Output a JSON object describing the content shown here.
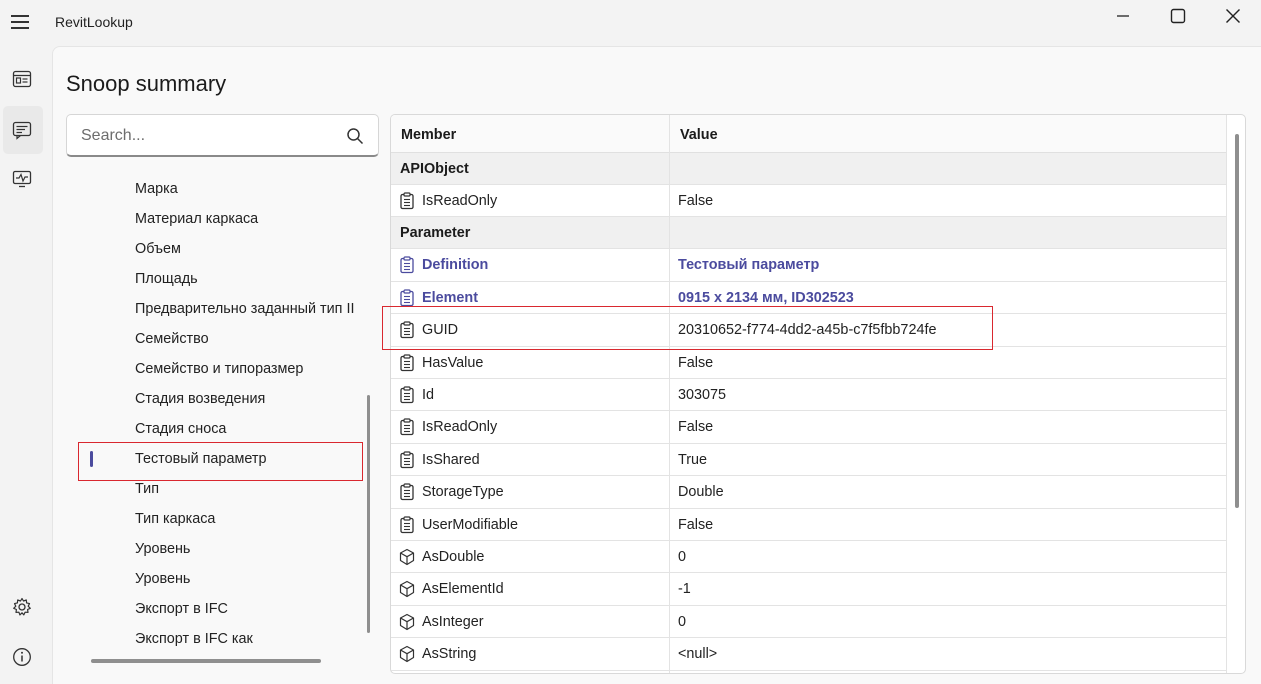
{
  "window": {
    "title": "RevitLookup",
    "icons": {
      "menu": "hamburger-icon",
      "minimize": "minimize-icon",
      "maximize": "maximize-icon",
      "close": "close-icon"
    }
  },
  "rail": {
    "items": [
      {
        "icon": "dashboard-icon"
      },
      {
        "icon": "snoop-summary-icon",
        "active": true
      },
      {
        "icon": "monitor-icon"
      }
    ],
    "bottom": [
      {
        "icon": "gear-icon"
      },
      {
        "icon": "info-icon"
      }
    ]
  },
  "page": {
    "title": "Snoop summary"
  },
  "search": {
    "placeholder": "Search...",
    "value": ""
  },
  "tree": {
    "items": [
      {
        "label": "Марка"
      },
      {
        "label": "Материал каркаса"
      },
      {
        "label": "Объем"
      },
      {
        "label": "Площадь"
      },
      {
        "label": "Предварительно заданный тип II"
      },
      {
        "label": "Семейство"
      },
      {
        "label": "Семейство и типоразмер"
      },
      {
        "label": "Стадия возведения"
      },
      {
        "label": "Стадия сноса"
      },
      {
        "label": "Тестовый параметр",
        "selected": true
      },
      {
        "label": "Тип"
      },
      {
        "label": "Тип каркаса"
      },
      {
        "label": "Уровень"
      },
      {
        "label": "Уровень"
      },
      {
        "label": "Экспорт в IFC"
      },
      {
        "label": "Экспорт в IFC как"
      }
    ]
  },
  "grid": {
    "headers": {
      "member": "Member",
      "value": "Value"
    },
    "rows": [
      {
        "type": "group",
        "name": "APIObject"
      },
      {
        "member": "IsReadOnly",
        "value": "False",
        "icon": "clipboard-icon"
      },
      {
        "type": "group",
        "name": "Parameter"
      },
      {
        "member": "Definition",
        "value": "Тестовый параметр",
        "icon": "clipboard-icon",
        "link": true
      },
      {
        "member": "Element",
        "value": "0915 x 2134 мм, ID302523",
        "icon": "clipboard-icon",
        "link": true
      },
      {
        "member": "GUID",
        "value": "20310652-f774-4dd2-a45b-c7f5fbb724fe",
        "icon": "clipboard-icon"
      },
      {
        "member": "HasValue",
        "value": "False",
        "icon": "clipboard-icon"
      },
      {
        "member": "Id",
        "value": "303075",
        "icon": "clipboard-icon"
      },
      {
        "member": "IsReadOnly",
        "value": "False",
        "icon": "clipboard-icon"
      },
      {
        "member": "IsShared",
        "value": "True",
        "icon": "clipboard-icon"
      },
      {
        "member": "StorageType",
        "value": "Double",
        "icon": "clipboard-icon"
      },
      {
        "member": "UserModifiable",
        "value": "False",
        "icon": "clipboard-icon"
      },
      {
        "member": "AsDouble",
        "value": "0",
        "icon": "cube-icon"
      },
      {
        "member": "AsElementId",
        "value": "-1",
        "icon": "cube-icon"
      },
      {
        "member": "AsInteger",
        "value": "0",
        "icon": "cube-icon"
      },
      {
        "member": "AsString",
        "value": "<null>",
        "icon": "cube-icon"
      }
    ]
  },
  "colors": {
    "accent": "#4b4b9e",
    "highlight": "#d9282f"
  }
}
